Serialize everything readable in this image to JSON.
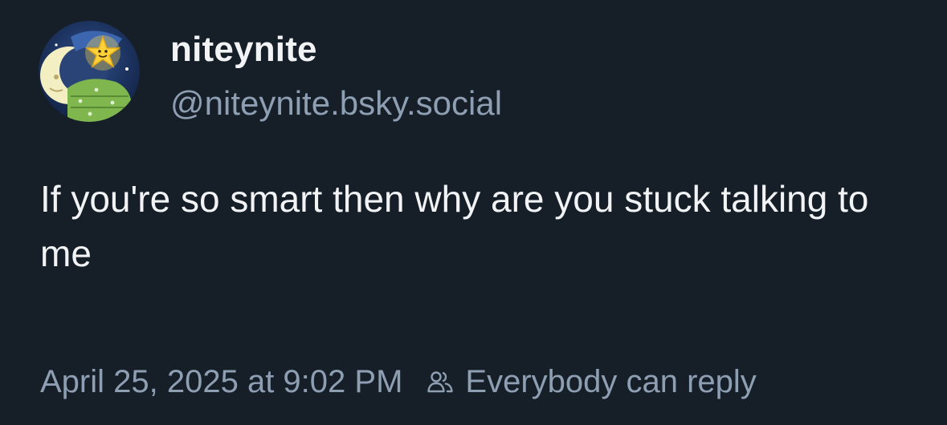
{
  "post": {
    "author": {
      "display_name": "niteynite",
      "handle": "@niteynite.bsky.social",
      "avatar_icon": "star-nightcap-avatar"
    },
    "text": "If you're so smart then why are you stuck talking to me",
    "timestamp": "April 25, 2025 at 9:02 PM",
    "reply_setting": {
      "icon": "people-icon",
      "label": "Everybody can reply"
    }
  },
  "colors": {
    "background": "#161e27",
    "primary_text": "#f1f3f5",
    "secondary_text": "#8e9fb3"
  }
}
